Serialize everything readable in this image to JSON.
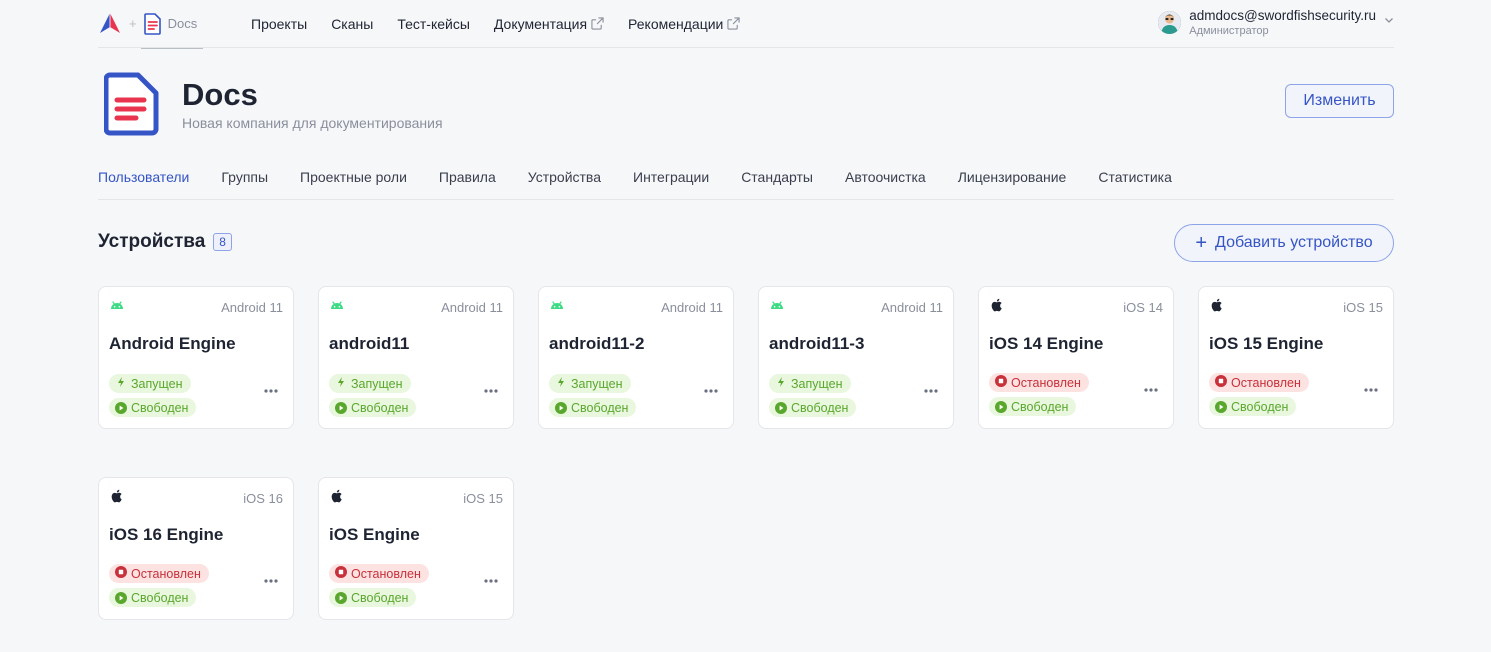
{
  "brand": {
    "docs_label": "Docs",
    "plus": "+"
  },
  "nav": [
    {
      "label": "Проекты",
      "external": false
    },
    {
      "label": "Сканы",
      "external": false
    },
    {
      "label": "Тест-кейсы",
      "external": false
    },
    {
      "label": "Документация",
      "external": true
    },
    {
      "label": "Рекомендации",
      "external": true
    }
  ],
  "user": {
    "email": "admdocs@swordfishsecurity.ru",
    "role": "Администратор"
  },
  "company": {
    "name": "Docs",
    "subtitle": "Новая компания для документирования",
    "edit_label": "Изменить"
  },
  "tabs": [
    {
      "label": "Пользователи",
      "active": true
    },
    {
      "label": "Группы",
      "active": false
    },
    {
      "label": "Проектные роли",
      "active": false
    },
    {
      "label": "Правила",
      "active": false
    },
    {
      "label": "Устройства",
      "active": false
    },
    {
      "label": "Интеграции",
      "active": false
    },
    {
      "label": "Стандарты",
      "active": false
    },
    {
      "label": "Автоочистка",
      "active": false
    },
    {
      "label": "Лицензирование",
      "active": false
    },
    {
      "label": "Статистика",
      "active": false
    }
  ],
  "section": {
    "title": "Устройства",
    "count": "8",
    "add_label": "Добавить устройство",
    "add_icon": "+"
  },
  "colors": {
    "accent": "#3555c6",
    "running": "#5aa72d",
    "stopped": "#c8303a",
    "android": "#3ddc84"
  },
  "devices": [
    {
      "name": "Android Engine",
      "os": "Android 11",
      "platform": "android",
      "state": "Запущен",
      "state_kind": "running",
      "availability": "Свободен"
    },
    {
      "name": "android11",
      "os": "Android 11",
      "platform": "android",
      "state": "Запущен",
      "state_kind": "running",
      "availability": "Свободен"
    },
    {
      "name": "android11-2",
      "os": "Android 11",
      "platform": "android",
      "state": "Запущен",
      "state_kind": "running",
      "availability": "Свободен"
    },
    {
      "name": "android11-3",
      "os": "Android 11",
      "platform": "android",
      "state": "Запущен",
      "state_kind": "running",
      "availability": "Свободен"
    },
    {
      "name": "iOS 14 Engine",
      "os": "iOS 14",
      "platform": "ios",
      "state": "Остановлен",
      "state_kind": "stopped",
      "availability": "Свободен"
    },
    {
      "name": "iOS 15 Engine",
      "os": "iOS 15",
      "platform": "ios",
      "state": "Остановлен",
      "state_kind": "stopped",
      "availability": "Свободен"
    },
    {
      "name": "iOS 16 Engine",
      "os": "iOS 16",
      "platform": "ios",
      "state": "Остановлен",
      "state_kind": "stopped",
      "availability": "Свободен"
    },
    {
      "name": "iOS Engine",
      "os": "iOS 15",
      "platform": "ios",
      "state": "Остановлен",
      "state_kind": "stopped",
      "availability": "Свободен"
    }
  ]
}
